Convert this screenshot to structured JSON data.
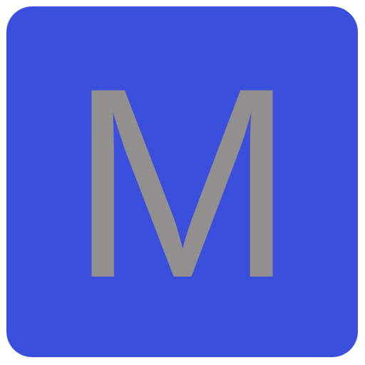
{
  "icon": {
    "letter": "M",
    "name": "m-letter-icon",
    "colors": {
      "background": "#3a4fdc",
      "letter": "#938f8f",
      "page": "#ffffff"
    }
  }
}
